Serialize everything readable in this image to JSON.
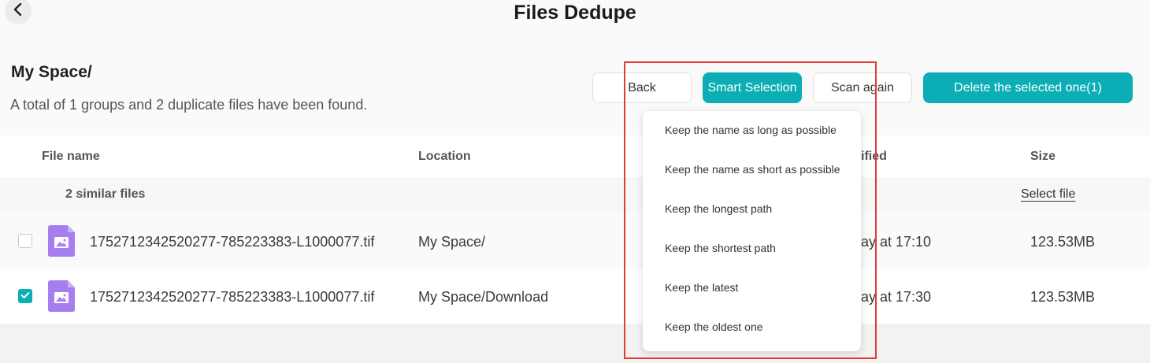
{
  "header": {
    "title": "Files Dedupe"
  },
  "breadcrumb": "My Space/",
  "summary": "A total of 1 groups and 2 duplicate files have been found.",
  "buttons": {
    "back": "Back",
    "smart_selection": "Smart Selection",
    "scan_again": "Scan again",
    "delete_selected": "Delete the selected one(1)"
  },
  "table": {
    "columns": {
      "file_name": "File name",
      "location": "Location",
      "modified": "ified",
      "size": "Size"
    },
    "group": {
      "label": "2 similar files",
      "select_file": "Select file"
    },
    "rows": [
      {
        "checked": false,
        "name": "1752712342520277-785223383-L1000077.tif",
        "location": "My Space/",
        "modified": "ay at 17:10",
        "size": "123.53MB"
      },
      {
        "checked": true,
        "name": "1752712342520277-785223383-L1000077.tif",
        "location": "My Space/Download",
        "modified": "ay at 17:30",
        "size": "123.53MB"
      }
    ]
  },
  "smart_menu": {
    "items": [
      "Keep the name as long as possible",
      "Keep the name as short as possible",
      "Keep the longest path",
      "Keep the shortest path",
      "Keep the latest",
      "Keep the oldest one"
    ]
  },
  "colors": {
    "accent": "#0aaeb4",
    "highlight": "#e53935",
    "file_icon": "#a77ef0"
  }
}
